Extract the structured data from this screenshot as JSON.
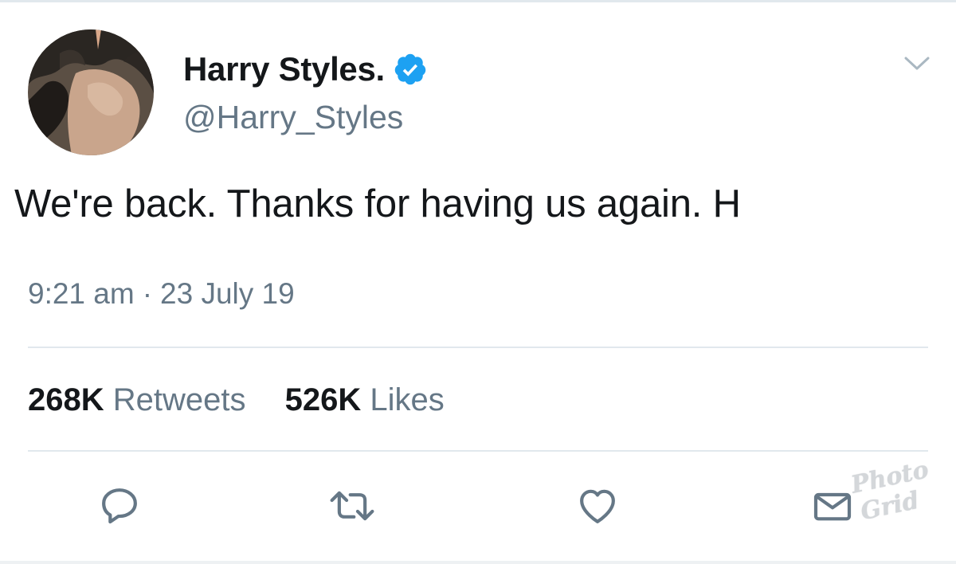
{
  "author": {
    "display_name": "Harry Styles.",
    "handle": "@Harry_Styles",
    "verified": true
  },
  "tweet": {
    "text": "We're back. Thanks for having us again. H",
    "time": "9:21 am",
    "separator": "·",
    "date": "23 July 19"
  },
  "stats": {
    "retweets_count": "268K",
    "retweets_label": "Retweets",
    "likes_count": "526K",
    "likes_label": "Likes"
  },
  "watermark": {
    "line1": "Photo",
    "line2": "Grid"
  },
  "colors": {
    "text_primary": "#14171a",
    "text_secondary": "#657786",
    "verified_blue": "#1da1f2",
    "icon_gray": "#657786",
    "divider": "#e1e8ed"
  },
  "icons": {
    "menu": "chevron-down-icon",
    "reply": "reply-icon",
    "retweet": "retweet-icon",
    "like": "heart-icon",
    "share": "envelope-icon",
    "verified": "verified-badge-icon"
  }
}
